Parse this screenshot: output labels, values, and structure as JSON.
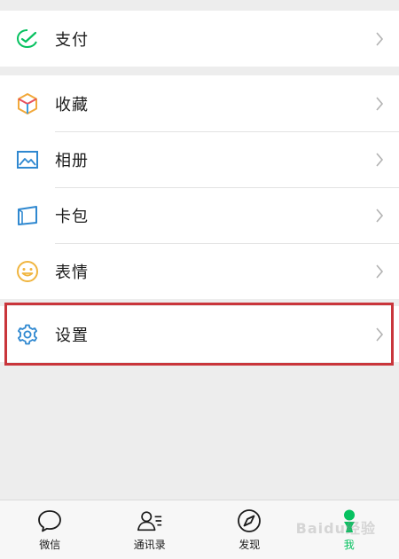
{
  "menu": {
    "pay": {
      "label": "支付",
      "icon": "wallet-check-icon"
    },
    "collection": [
      {
        "key": "favorites",
        "label": "收藏",
        "icon": "cube-icon"
      },
      {
        "key": "album",
        "label": "相册",
        "icon": "image-icon"
      },
      {
        "key": "cards",
        "label": "卡包",
        "icon": "card-wallet-icon"
      },
      {
        "key": "stickers",
        "label": "表情",
        "icon": "smiley-icon"
      }
    ],
    "settings": {
      "label": "设置",
      "icon": "gear-icon"
    }
  },
  "tabs": [
    {
      "label": "微信",
      "icon": "chat-bubble-icon",
      "active": false
    },
    {
      "label": "通讯录",
      "icon": "contacts-icon",
      "active": false
    },
    {
      "label": "发现",
      "icon": "compass-icon",
      "active": false
    },
    {
      "label": "我",
      "icon": "person-icon",
      "active": true
    }
  ],
  "watermark": "Baidu经验",
  "colors": {
    "accent": "#07c160",
    "highlight": "#c9353b",
    "background": "#ededed"
  }
}
